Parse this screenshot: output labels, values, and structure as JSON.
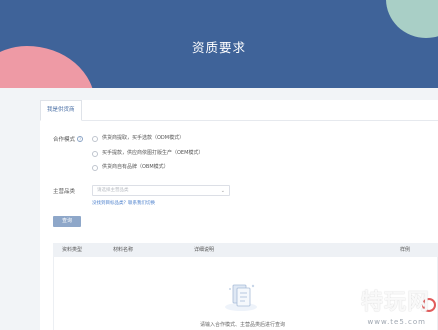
{
  "hero": {
    "title": "资质要求"
  },
  "tabs": [
    {
      "label": "我是供货商"
    }
  ],
  "form": {
    "cooperation_label": "合作模式",
    "help_char": "?",
    "radios": [
      "供货商提取，买手选款（ODM模式）",
      "买手提款，供应商依图打版生产（OEM模式）",
      "供货商自有品牌（OBM模式）"
    ],
    "category_label": "主营品类",
    "category_placeholder": "请选择主营品类",
    "link_text": "没找到目标品类？联系我们切换",
    "query_button": "查询"
  },
  "table": {
    "headers": [
      "资料类型",
      "材料名称",
      "详细说明",
      "样例"
    ]
  },
  "empty_state": {
    "text": "请输入合作模式、主营品类后进行查询"
  },
  "watermark": {
    "big": "特玩网",
    "small": "www.te5.com"
  },
  "colors": {
    "hero": "#3f6399",
    "pink": "#ee9aa5",
    "teal": "#a9cfc6",
    "button": "#8ea7c9",
    "link": "#4a7fcc"
  }
}
